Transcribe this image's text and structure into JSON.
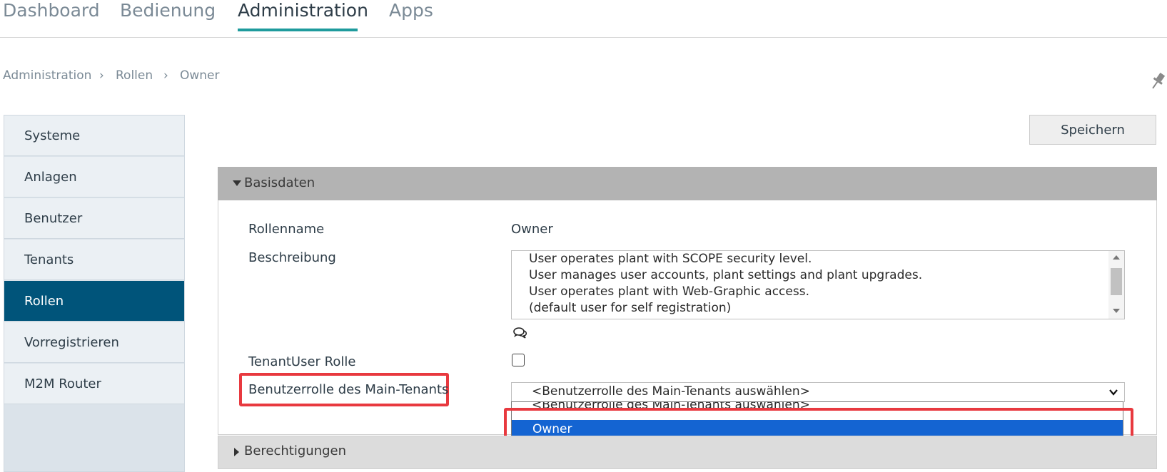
{
  "nav": {
    "tabs": [
      {
        "label": "Dashboard"
      },
      {
        "label": "Bedienung"
      },
      {
        "label": "Administration"
      },
      {
        "label": "Apps"
      }
    ],
    "active_tab": "Administration",
    "accent_color": "#1f9b9d"
  },
  "breadcrumb": {
    "items": [
      "Administration",
      "Rollen",
      "Owner"
    ],
    "separator": ">"
  },
  "sidebar": {
    "items": [
      {
        "label": "Systeme"
      },
      {
        "label": "Anlagen"
      },
      {
        "label": "Benutzer"
      },
      {
        "label": "Tenants"
      },
      {
        "label": "Rollen"
      },
      {
        "label": "Vorregistrieren"
      },
      {
        "label": "M2M Router"
      }
    ],
    "active_item": "Rollen",
    "active_color": "#00547a"
  },
  "toolbar": {
    "save_label": "Speichern"
  },
  "basisdaten": {
    "title": "Basisdaten",
    "fields": {
      "rollenname_label": "Rollenname",
      "rollenname_value": "Owner",
      "beschreibung_label": "Beschreibung",
      "beschreibung_lines": [
        "User operates plant with SCOPE security level.",
        "User manages user accounts, plant settings and plant upgrades.",
        "User operates plant with Web-Graphic access.",
        "(default user for self registration)"
      ],
      "tenantuser_label": "TenantUser Rolle",
      "tenantuser_checked": false,
      "main_tenant_label": "Benutzerrolle des Main-Tenants",
      "main_tenant_selected": "<Benutzerrolle des Main-Tenants auswählen>",
      "main_tenant_options": [
        "<Benutzerrolle des Main-Tenants auswählen>",
        "Owner"
      ],
      "main_tenant_highlighted_option": "Owner"
    }
  },
  "berechtigungen": {
    "title": "Berechtigungen"
  },
  "colors": {
    "highlight_box": "#e8393f",
    "selected_option": "#1464d2",
    "panel_header": "#b3b3b3"
  },
  "icons": [
    "breadcrumb-chevron-icon",
    "pin-icon",
    "caret-down-icon",
    "chat-bubbles-icon",
    "chevron-down-icon",
    "caret-right-icon"
  ]
}
